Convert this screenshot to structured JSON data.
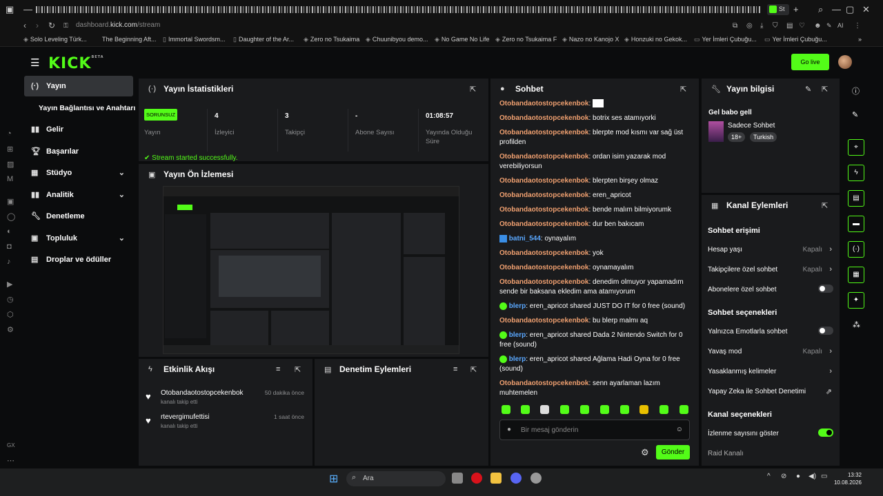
{
  "browser": {
    "active_tab": "St",
    "url_prefix": "dashboard.",
    "url_domain": "kick.com",
    "url_path": "/stream",
    "bookmarks": [
      "Solo Leveling Türk...",
      "The Beginning Aft...",
      "Immortal Swordsm...",
      "Daughter of the Ar...",
      "Zero no Tsukaima",
      "Chuunibyou demo...",
      "No Game No Life",
      "Zero no Tsukaima F",
      "Nazo no Kanojo X",
      "Honzuki no Gekok...",
      "Yer İmleri Çubuğu...",
      "Yer İmleri Çubuğu..."
    ],
    "ai_label": "AI"
  },
  "header": {
    "logo": "KICK",
    "logo_sup": "BETA",
    "go_live": "Go live"
  },
  "sidebar": {
    "items": [
      {
        "label": "Yayın",
        "icon": "broadcast-icon",
        "active": true
      },
      {
        "label": "Yayın Bağlantısı ve Anahtarı",
        "icon": "",
        "sub": true
      },
      {
        "label": "Gelir",
        "icon": "chart-icon"
      },
      {
        "label": "Başarılar",
        "icon": "trophy-icon"
      },
      {
        "label": "Stüdyo",
        "icon": "studio-icon",
        "chevron": true
      },
      {
        "label": "Analitik",
        "icon": "analytics-icon",
        "chevron": true
      },
      {
        "label": "Denetleme",
        "icon": "wrench-icon"
      },
      {
        "label": "Topluluk",
        "icon": "community-icon",
        "chevron": true
      },
      {
        "label": "Droplar ve ödüller",
        "icon": "gift-icon"
      }
    ]
  },
  "stats": {
    "title": "Yayın İstatistikleri",
    "status_badge": "SORUNSUZ",
    "items": [
      {
        "value": "",
        "label": "Yayın"
      },
      {
        "value": "4",
        "label": "İzleyici"
      },
      {
        "value": "3",
        "label": "Takipçi"
      },
      {
        "value": "-",
        "label": "Abone Sayısı"
      },
      {
        "value": "01:08:57",
        "label": "Yayında Olduğu Süre"
      }
    ],
    "message": "Stream started successfully."
  },
  "preview": {
    "title": "Yayın Ön İzlemesi"
  },
  "activity": {
    "title": "Etkinlik Akışı",
    "items": [
      {
        "name": "Otobandaotostopcekenbok",
        "sub": "kanalı takip etti",
        "time": "50 dakika önce"
      },
      {
        "name": "rtevergimufettisi",
        "sub": "kanalı takip etti",
        "time": "1 saat önce"
      }
    ]
  },
  "moderation": {
    "title": "Denetim Eylemleri"
  },
  "chat": {
    "title": "Sohbet",
    "messages": [
      {
        "user": "Otobandaotostopcekenbok",
        "text": ""
      },
      {
        "user": "Otobandaotostopcekenbok",
        "text": "botrix ses atamıyorki"
      },
      {
        "user": "Otobandaotostopcekenbok",
        "text": "blerpte mod kısmı var sağ üst profilden"
      },
      {
        "user": "Otobandaotostopcekenbok",
        "text": "ordan isim yazarak mod verebiliyorsun"
      },
      {
        "user": "Otobandaotostopcekenbok",
        "text": "blerpten birşey olmaz"
      },
      {
        "user": "Otobandaotostopcekenbok",
        "text": "eren_apricot"
      },
      {
        "user": "Otobandaotostopcekenbok",
        "text": "bende malım bilmiyorumk"
      },
      {
        "user": "Otobandaotostopcekenbok",
        "text": "dur ben bakıcam"
      },
      {
        "user": "batni_544",
        "text": "oynayalım",
        "alt": true
      },
      {
        "user": "Otobandaotostopcekenbok",
        "text": "yok"
      },
      {
        "user": "Otobandaotostopcekenbok",
        "text": "oynamayalım"
      },
      {
        "user": "Otobandaotostopcekenbok",
        "text": "denedim olmuyor yapamadım sende bir baksana ekledim ama atamıyorum"
      },
      {
        "user": "blerp",
        "text": "eren_apricot shared JUST DO IT for 0 free (sound)",
        "alt": true
      },
      {
        "user": "Otobandaotostopcekenbok",
        "text": "bu blerp malmı aq"
      },
      {
        "user": "blerp",
        "text": "eren_apricot shared Dada 2 Nintendo Switch for 0 free (sound)",
        "alt": true
      },
      {
        "user": "blerp",
        "text": "eren_apricot shared Ağlama Hadi Oyna for 0 free (sound)",
        "alt": true
      },
      {
        "user": "Otobandaotostopcekenbok",
        "text": "senn ayarlaman lazım muhtemelen"
      }
    ],
    "input_placeholder": "Bir mesaj gönderin",
    "send": "Gönder"
  },
  "stream_info": {
    "title": "Yayın bilgisi",
    "stream_title": "Gel babo gell",
    "category": "Sadece Sohbet",
    "tags": [
      "18+",
      "Turkish"
    ]
  },
  "channel_actions": {
    "title": "Kanal Eylemleri",
    "chat_access": "Sohbet erişimi",
    "account_age": {
      "label": "Hesap yaşı",
      "value": "Kapalı"
    },
    "followers_only": {
      "label": "Takipçilere özel sohbet",
      "value": "Kapalı"
    },
    "subs_only": {
      "label": "Abonelere özel sohbet",
      "on": false
    },
    "chat_options": "Sohbet seçenekleri",
    "emotes_only": {
      "label": "Yalnızca Emotlarla sohbet",
      "on": false
    },
    "slow_mode": {
      "label": "Yavaş mod",
      "value": "Kapalı"
    },
    "banned_words": {
      "label": "Yasaklanmış kelimeler"
    },
    "ai_mod": {
      "label": "Yapay Zeka ile Sohbet Denetimi"
    },
    "channel_options": "Kanal seçenekleri",
    "show_viewers": {
      "label": "İzlenme sayısını göster",
      "on": true
    },
    "raid": {
      "label": "Raid Kanalı"
    }
  },
  "taskbar": {
    "search_placeholder": "Ara",
    "time": "13:32",
    "date": "10.08.2026"
  },
  "colors": {
    "accent": "#53fc18",
    "panel": "#1a1b1d",
    "username": "#f0a070"
  }
}
